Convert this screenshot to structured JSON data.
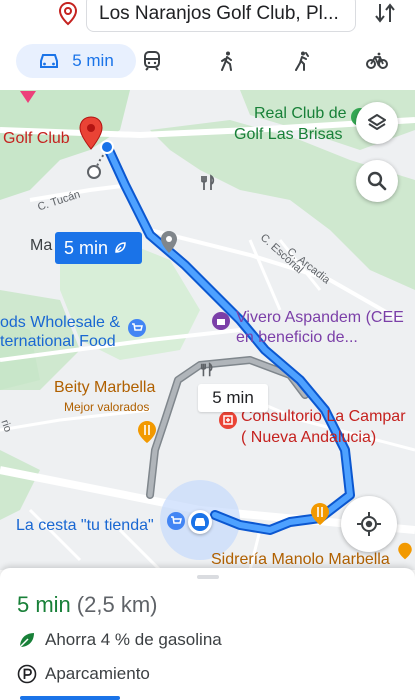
{
  "search": {
    "destination": "Los Naranjos Golf Club, Pl..."
  },
  "modes": {
    "drive_time": "5 min"
  },
  "map": {
    "labels": {
      "golf_club": "Golf Club",
      "real_club_line1": "Real Club de",
      "real_club_line2": "Golf Las Brisas",
      "c_tucan": "C. Tucán",
      "ma": "Ma",
      "c_escorial": "C. Escorial",
      "c_arcadia": "C. Arcadia",
      "foods_line1": "ods Wholesale &",
      "foods_line2": "ternational Food",
      "vivero_line1": "Vivero Aspandem (CEE",
      "vivero_line2": "en beneficio de...",
      "beity_name": "Beity Marbella",
      "beity_sub": "Mejor valorados",
      "consultorio_line1": "Consultorio La Campar",
      "consultorio_line2": "( Nueva Andalucia)",
      "la_cesta": "La cesta \"tu tienda\"",
      "sidreria": "Sidrería Manolo Marbella",
      "edge_rio": "rio"
    },
    "route_bubble_primary": "5 min",
    "route_bubble_alt": "5 min"
  },
  "sheet": {
    "eta_time": "5 min",
    "eta_distance": "(2,5 km)",
    "eco_text": "Ahorra 4 % de gasolina",
    "parking_text": "Aparcamiento"
  },
  "colors": {
    "route": "#1a73e8",
    "route_outline": "#0b57d0",
    "alt_route": "#9aa0a6",
    "green_area": "#c8e6c9",
    "accent_green": "#188038"
  }
}
